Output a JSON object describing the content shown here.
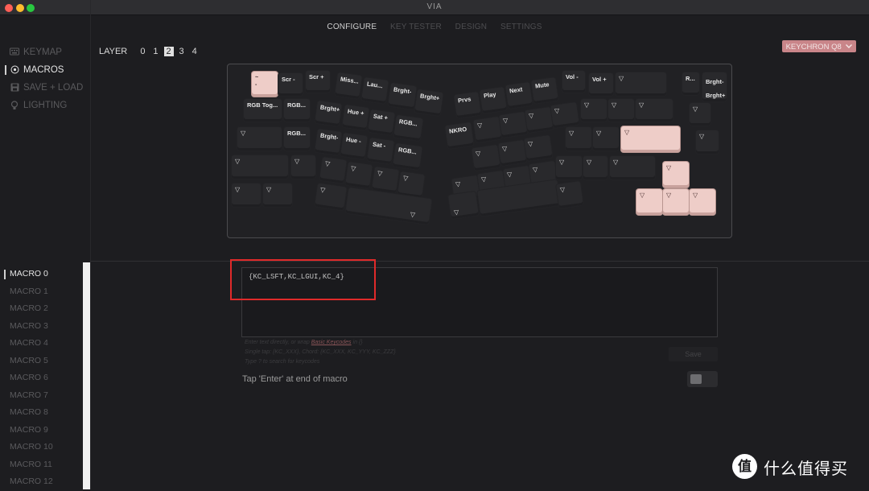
{
  "window": {
    "title": "VIA",
    "traffic": {
      "close": "#fe5f57",
      "minimize": "#febc2e",
      "maximize": "#28c840"
    }
  },
  "topnav": {
    "tabs": [
      "CONFIGURE",
      "KEY TESTER",
      "DESIGN",
      "SETTINGS"
    ],
    "active": "CONFIGURE"
  },
  "sidenav": {
    "items": [
      {
        "label": "KEYMAP",
        "icon": "keyboard-icon"
      },
      {
        "label": "MACROS",
        "icon": "target-icon",
        "active": true
      },
      {
        "label": "SAVE + LOAD",
        "icon": "floppy-icon"
      },
      {
        "label": "LIGHTING",
        "icon": "bulb-icon"
      }
    ]
  },
  "layer": {
    "label": "LAYER",
    "options": [
      "0",
      "1",
      "2",
      "3",
      "4"
    ],
    "selected": "2"
  },
  "profile": {
    "label": "KEYCHRON Q8"
  },
  "keys": {
    "k_esc": "~\n-",
    "scr_minus": "Scr -",
    "scr_plus": "Scr +",
    "miss": "Miss...",
    "lau": "Lau...",
    "brght_minus_1": "Brght-",
    "brght_plus_1": "Brght+",
    "prvs": "Prvs",
    "play": "Play",
    "next": "Next",
    "mute": "Mute",
    "vol_minus": "Vol -",
    "vol_plus": "Vol +",
    "r_dots": "R...",
    "brght_minus_2": "Brght-",
    "brght_plus_2": "Brght+",
    "rgb_tog": "RGB Tog...",
    "rgb_1": "RGB...",
    "brght_plus_3": "Brght+",
    "hue_plus": "Hue +",
    "sat_plus": "Sat +",
    "rgb_2": "RGB...",
    "nkro": "NKRO",
    "rgb_3": "RGB...",
    "brght_minus_3": "Brght-",
    "hue_minus": "Hue -",
    "sat_minus": "Sat -",
    "rgb_4": "RGB..."
  },
  "macros": {
    "items": [
      "MACRO 0",
      "MACRO 1",
      "MACRO 2",
      "MACRO 3",
      "MACRO 4",
      "MACRO 5",
      "MACRO 6",
      "MACRO 7",
      "MACRO 8",
      "MACRO 9",
      "MACRO 10",
      "MACRO 11",
      "MACRO 12"
    ],
    "selected": "MACRO 0"
  },
  "editor": {
    "value": "{KC_LSFT,KC_LGUI,KC_4}",
    "help_1_prefix": "Enter text directly, or wrap",
    "help_1_link": "Basic Keycodes",
    "help_1_suffix": "in {}",
    "help_2": "Single tap: {KC_XXX}, Chord: {KC_XXX, KC_YYY, KC_ZZZ}",
    "help_3": "Type ? to search for keycodes",
    "save_label": "Save",
    "enter_label": "Tap 'Enter' at end of macro",
    "enter_toggle": false
  },
  "watermark": {
    "symbol": "值",
    "text": "什么值得买"
  }
}
